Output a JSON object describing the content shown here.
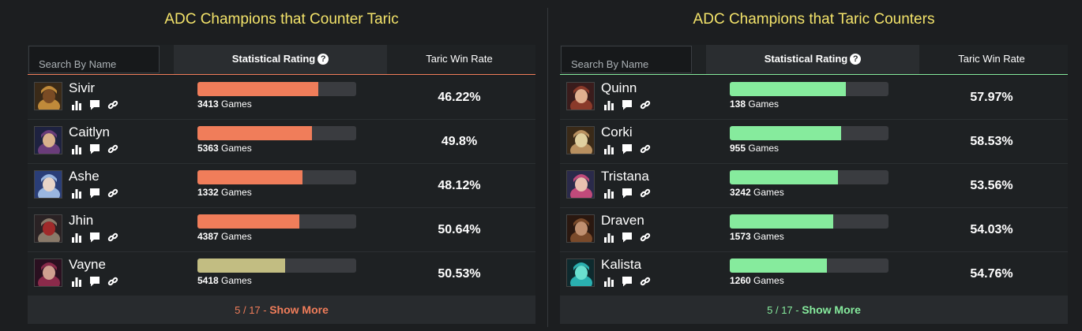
{
  "colors": {
    "title": "#f3e36a",
    "counter_bar": "#f07d5a",
    "neutral_bar": "#c2bd82",
    "countered_bar": "#86eb9d"
  },
  "panels": [
    {
      "title": "ADC Champions that Counter Taric",
      "search_placeholder": "Search By Name",
      "rating_header": "Statistical Rating",
      "winrate_header": "Taric Win Rate",
      "footer_count": "5 / 17 - ",
      "footer_more": "Show More",
      "rows": [
        {
          "name": "Sivir",
          "rating": 0.76,
          "games": "3413",
          "games_label": "Games",
          "winrate": "46.22%",
          "bar_color": "#f07d5a",
          "avatar": "sivir-portrait"
        },
        {
          "name": "Caitlyn",
          "rating": 0.72,
          "games": "5363",
          "games_label": "Games",
          "winrate": "49.8%",
          "bar_color": "#f07d5a",
          "avatar": "caitlyn-portrait"
        },
        {
          "name": "Ashe",
          "rating": 0.66,
          "games": "1332",
          "games_label": "Games",
          "winrate": "48.12%",
          "bar_color": "#f07d5a",
          "avatar": "ashe-portrait"
        },
        {
          "name": "Jhin",
          "rating": 0.64,
          "games": "4387",
          "games_label": "Games",
          "winrate": "50.64%",
          "bar_color": "#f07d5a",
          "avatar": "jhin-portrait"
        },
        {
          "name": "Vayne",
          "rating": 0.55,
          "games": "5418",
          "games_label": "Games",
          "winrate": "50.53%",
          "bar_color": "#c2bd82",
          "avatar": "vayne-portrait"
        }
      ]
    },
    {
      "title": "ADC Champions that Taric Counters",
      "search_placeholder": "Search By Name",
      "rating_header": "Statistical Rating",
      "winrate_header": "Taric Win Rate",
      "footer_count": "5 / 17 - ",
      "footer_more": "Show More",
      "rows": [
        {
          "name": "Quinn",
          "rating": 0.73,
          "games": "138",
          "games_label": "Games",
          "winrate": "57.97%",
          "bar_color": "#86eb9d",
          "avatar": "quinn-portrait"
        },
        {
          "name": "Corki",
          "rating": 0.7,
          "games": "955",
          "games_label": "Games",
          "winrate": "58.53%",
          "bar_color": "#86eb9d",
          "avatar": "corki-portrait"
        },
        {
          "name": "Tristana",
          "rating": 0.68,
          "games": "3242",
          "games_label": "Games",
          "winrate": "53.56%",
          "bar_color": "#86eb9d",
          "avatar": "tristana-portrait"
        },
        {
          "name": "Draven",
          "rating": 0.65,
          "games": "1573",
          "games_label": "Games",
          "winrate": "54.03%",
          "bar_color": "#86eb9d",
          "avatar": "draven-portrait"
        },
        {
          "name": "Kalista",
          "rating": 0.61,
          "games": "1260",
          "games_label": "Games",
          "winrate": "54.76%",
          "bar_color": "#86eb9d",
          "avatar": "kalista-portrait"
        }
      ]
    }
  ],
  "help_icon": "question-circle-icon",
  "row_icons": [
    "stats-icon",
    "comment-icon",
    "link-icon"
  ]
}
